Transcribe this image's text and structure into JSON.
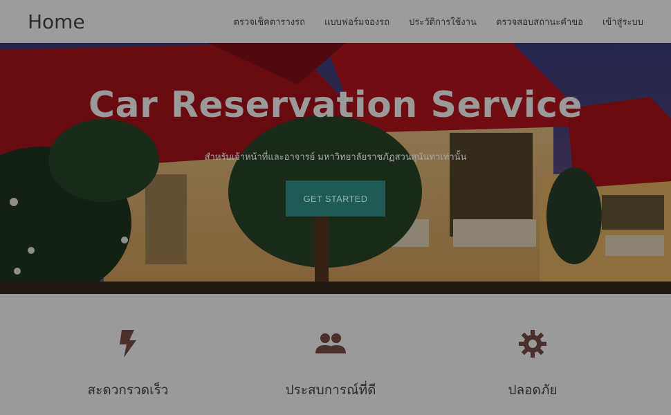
{
  "navbar": {
    "brand": "Home",
    "links": [
      {
        "label": "ตรวจเช็คตารางรถ"
      },
      {
        "label": "แบบฟอร์มจองรถ"
      },
      {
        "label": "ประวัติการใช้งาน"
      },
      {
        "label": "ตรวจสอบสถานะคำขอ"
      },
      {
        "label": "เข้าสู่ระบบ"
      }
    ]
  },
  "hero": {
    "title": "Car Reservation Service",
    "subtitle": "สำหรับเจ้าหน้าที่และอาจารย์ มหาวิทยาลัยราชภัฏสวนสุนันทาเท่านั้น",
    "cta_label": "GET STARTED"
  },
  "features": [
    {
      "icon": "bolt-icon",
      "label": "สะดวกรวดเร็ว"
    },
    {
      "icon": "people-icon",
      "label": "ประสบการณ์ที่ดี"
    },
    {
      "icon": "gear-icon",
      "label": "ปลอดภัย"
    }
  ],
  "colors": {
    "overlay": "#000000",
    "cta_background": "#1f5a55",
    "roof_red": "#b3141c",
    "feature_icon": "#4a2f2a"
  }
}
